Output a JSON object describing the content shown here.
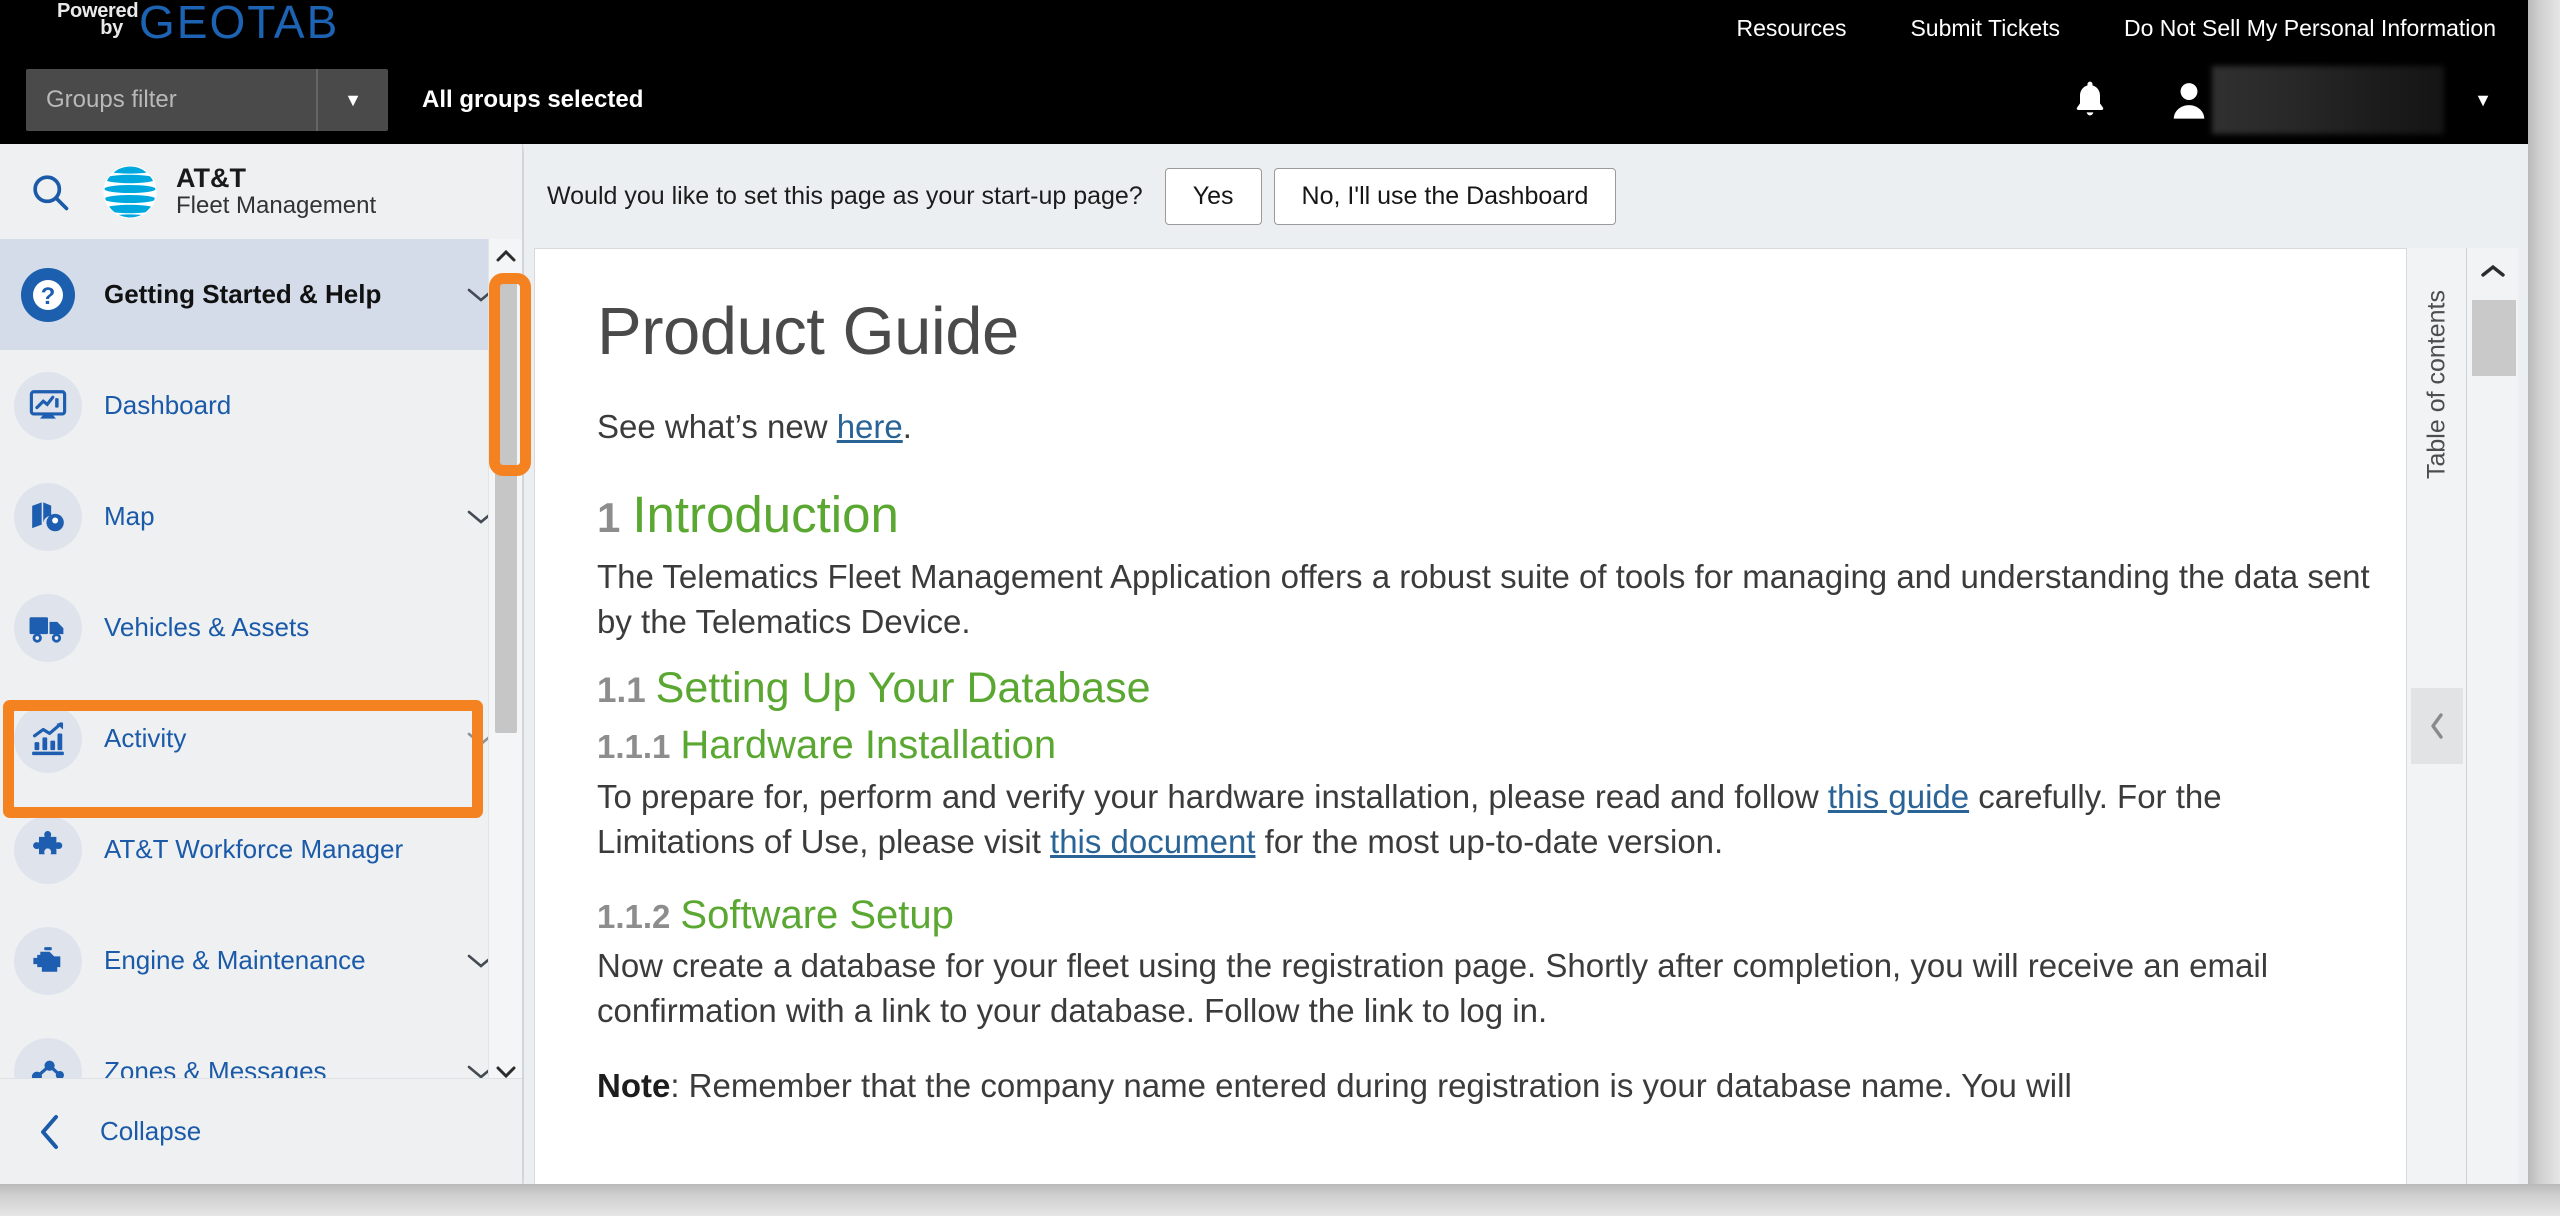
{
  "topbar": {
    "powered_line1": "Powered",
    "powered_line2": "by",
    "brand": "GEOTAB",
    "nav": [
      {
        "label": "Resources",
        "name": "resources"
      },
      {
        "label": "Submit Tickets",
        "name": "submit-tickets"
      },
      {
        "label": "Do Not Sell My Personal Information",
        "name": "do-not-sell"
      }
    ],
    "groups_filter_placeholder": "Groups filter",
    "groups_selected": "All groups selected",
    "caret": "▼",
    "user_caret": "▼",
    "icons": {
      "bell": "notification-bell-icon",
      "person": "user-avatar-icon"
    }
  },
  "sidebar": {
    "search_icon": "search-icon",
    "logo": {
      "line1": "AT&T",
      "line2": "Fleet Management"
    },
    "items": [
      {
        "label": "Getting Started & Help",
        "chevron": "⌄",
        "active": true,
        "icon": "question-mark-icon"
      },
      {
        "label": "Dashboard",
        "chevron": "",
        "active": false,
        "icon": "dashboard-monitor-icon"
      },
      {
        "label": "Map",
        "chevron": "⌄",
        "active": false,
        "icon": "map-pin-icon"
      },
      {
        "label": "Vehicles & Assets",
        "chevron": "",
        "active": false,
        "icon": "truck-icon"
      },
      {
        "label": "Activity",
        "chevron": "⌄",
        "active": false,
        "icon": "bar-chart-trend-icon",
        "highlighted": true
      },
      {
        "label": "AT&T Workforce Manager",
        "chevron": "",
        "active": false,
        "icon": "puzzle-piece-icon"
      },
      {
        "label": "Engine & Maintenance",
        "chevron": "⌄",
        "active": false,
        "icon": "engine-icon"
      },
      {
        "label": "Zones & Messages",
        "chevron": "⌄",
        "active": false,
        "icon": "zones-nodes-icon"
      }
    ],
    "collapse": {
      "label": "Collapse",
      "icon": "‹"
    },
    "scroll_up": "⌃",
    "scroll_down": "⌄"
  },
  "banner": {
    "question": "Would you like to set this page as your start-up page?",
    "yes_label": "Yes",
    "no_label": "No, I'll use the Dashboard"
  },
  "document": {
    "title": "Product Guide",
    "whats_new_prefix": "See what’s new ",
    "whats_new_link": "here",
    "whats_new_suffix": ".",
    "sections": {
      "intro_num": "1",
      "intro_title": "Introduction",
      "intro_body": "The Telematics Fleet Management Application offers a robust suite of tools for managing and understanding the data sent by the Telematics Device.",
      "db_num": "1.1",
      "db_title": "Setting Up Your Database",
      "hw_num": "1.1.1",
      "hw_title": "Hardware Installation",
      "hw_body_1": "To prepare for, perform and verify your hardware installation, please read and follow ",
      "hw_link_1": "this guide",
      "hw_body_2": " carefully. For the Limitations of Use, please visit ",
      "hw_link_2": "this document",
      "hw_body_3": " for the most up-to-date version.",
      "sw_num": "1.1.2",
      "sw_title": "Software Setup",
      "sw_body": "Now create a database for your fleet using the registration page. Shortly after completion, you will receive an email confirmation with a link to your database. Follow the link to log in.",
      "note_label": "Note",
      "note_body": ": Remember that the company name entered during registration is your database name. You will"
    }
  },
  "toc": {
    "label": "Table of contents",
    "handle_icon": "‹"
  },
  "main_scroll": {
    "up": "⌃"
  },
  "colors": {
    "accent_orange": "#f58220",
    "brand_blue": "#1d63b4",
    "link_blue": "#2a6496",
    "heading_green": "#5aa832",
    "sidebar_link": "#1b5aa8",
    "topbar_black": "#000000"
  }
}
